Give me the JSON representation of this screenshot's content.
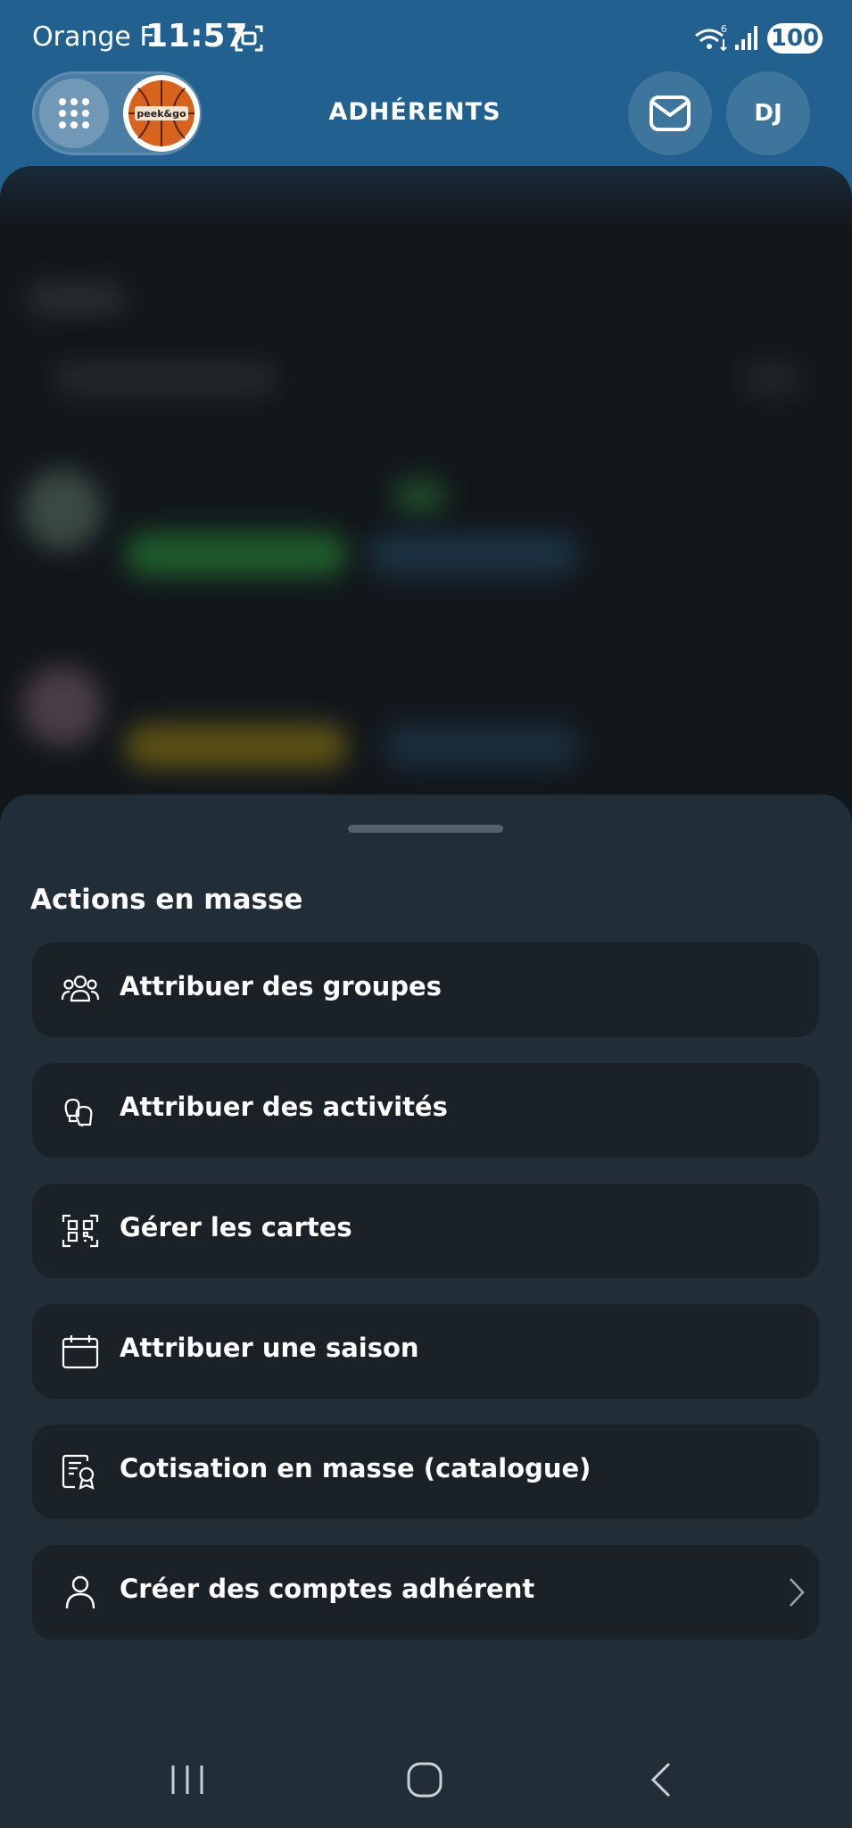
{
  "status_bar": {
    "carrier": "Orange F",
    "time": "11:57",
    "battery": "100",
    "icons": [
      "screenshot-icon",
      "wifi-6-icon",
      "signal-icon"
    ]
  },
  "header": {
    "title": "ADHÉRENTS",
    "avatar_initials": "DJ",
    "club_logo_text": "peek&go",
    "icons": [
      "grid-menu-icon",
      "mail-icon"
    ]
  },
  "sheet": {
    "title": "Actions en masse",
    "actions": [
      {
        "label": "Attribuer des groupes",
        "icon": "users-group-icon"
      },
      {
        "label": "Attribuer des activités",
        "icon": "boxing-gloves-icon"
      },
      {
        "label": "Gérer les cartes",
        "icon": "qr-code-icon"
      },
      {
        "label": "Attribuer une saison",
        "icon": "calendar-icon"
      },
      {
        "label": "Cotisation en masse (catalogue)",
        "icon": "certificate-icon"
      },
      {
        "label": "Créer des comptes adhérent",
        "icon": "user-icon",
        "has_chevron": true
      }
    ]
  },
  "navbar": {
    "icons": [
      "recent-apps-icon",
      "home-icon",
      "back-icon"
    ]
  },
  "colors": {
    "header_bg": "#22618f",
    "sheet_bg": "#222e37",
    "action_bg": "#1a2227",
    "text": "#ffffff"
  }
}
